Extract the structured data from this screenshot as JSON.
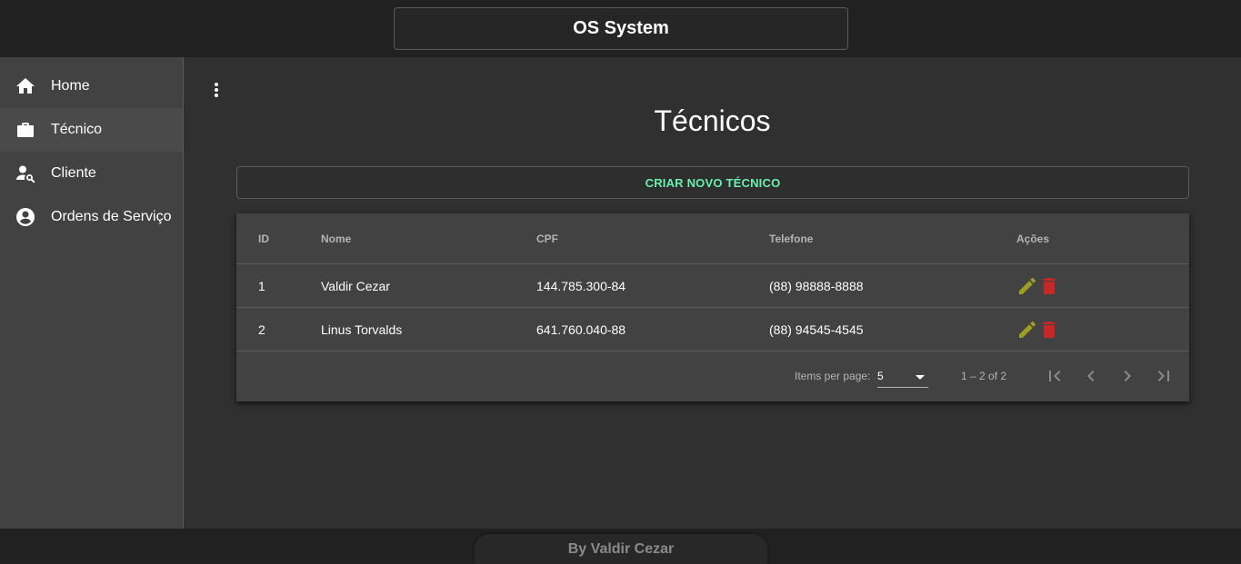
{
  "header": {
    "title": "OS System"
  },
  "sidebar": {
    "items": [
      {
        "label": "Home",
        "icon": "home-icon"
      },
      {
        "label": "Técnico",
        "icon": "briefcase-icon",
        "active": true
      },
      {
        "label": "Cliente",
        "icon": "person-search-icon"
      },
      {
        "label": "Ordens de Serviço",
        "icon": "account-circle-icon"
      }
    ]
  },
  "main": {
    "menu_icon": "more-vert-icon",
    "title": "Técnicos",
    "create_button": "CRIAR NOVO TÉCNICO",
    "table": {
      "columns": [
        "ID",
        "Nome",
        "CPF",
        "Telefone",
        "Ações"
      ],
      "rows": [
        {
          "id": "1",
          "nome": "Valdir Cezar",
          "cpf": "144.785.300-84",
          "telefone": "(88) 98888-8888"
        },
        {
          "id": "2",
          "nome": "Linus Torvalds",
          "cpf": "641.760.040-88",
          "telefone": "(88) 94545-4545"
        }
      ],
      "row_actions": [
        "edit-icon",
        "delete-icon"
      ]
    },
    "paginator": {
      "items_per_page_label": "Items per page:",
      "items_per_page": "5",
      "range": "1 – 2 of 2",
      "buttons": [
        "first-page-icon",
        "previous-page-icon",
        "next-page-icon",
        "last-page-icon"
      ]
    }
  },
  "footer": {
    "text": "By Valdir Cezar"
  },
  "colors": {
    "accent_green": "#69f0ae",
    "edit_icon": "#9e9d24",
    "delete_icon": "#c62828",
    "surface": "#424242",
    "background": "#303030",
    "toolbar": "#212121"
  }
}
